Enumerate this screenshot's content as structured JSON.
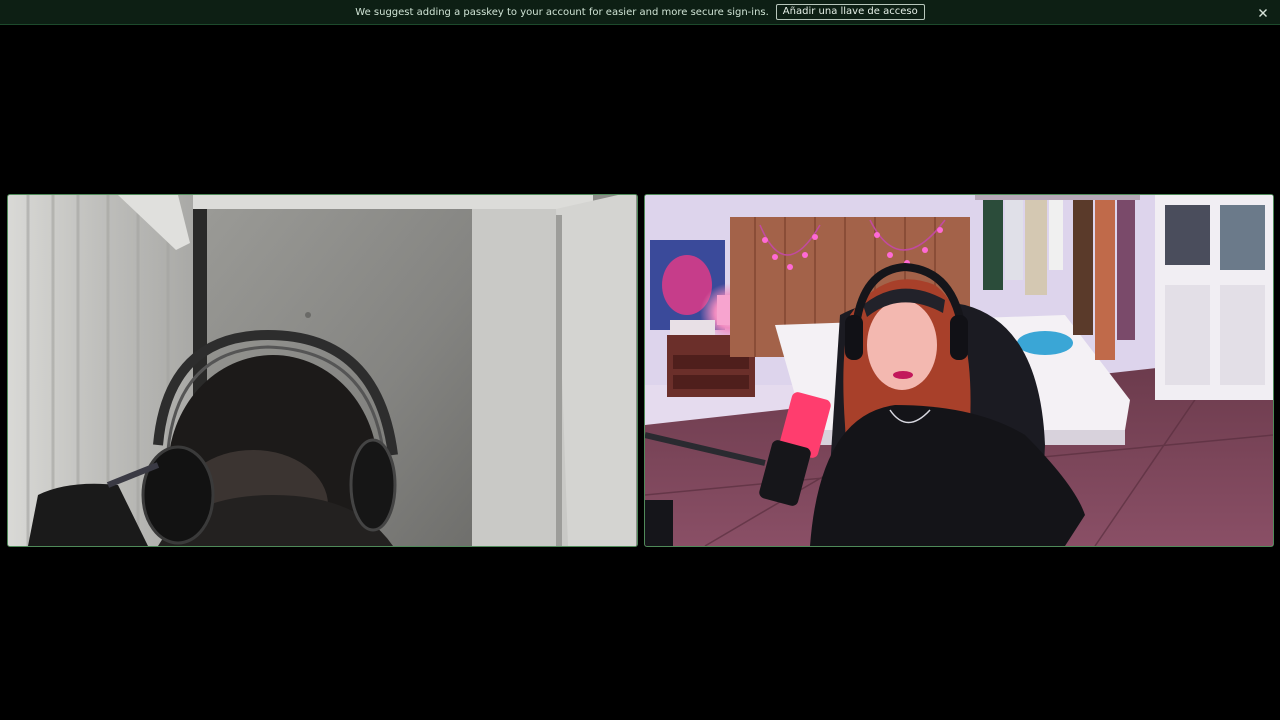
{
  "banner": {
    "message": "We suggest adding a passkey to your account for easier and more secure sign-ins.",
    "action_label": "Añadir una llave de acceso",
    "close_icon": "close-icon"
  },
  "colors": {
    "background": "#000000",
    "banner_bg": "#0d1f14",
    "tile_border": "#4f8a59"
  },
  "video_tiles": [
    {
      "id": "participant-1",
      "scene": "man with headphones in a room with grey wall and white curtains"
    },
    {
      "id": "participant-2",
      "scene": "woman with headset and pink microphone in a bedroom with string lights"
    }
  ]
}
